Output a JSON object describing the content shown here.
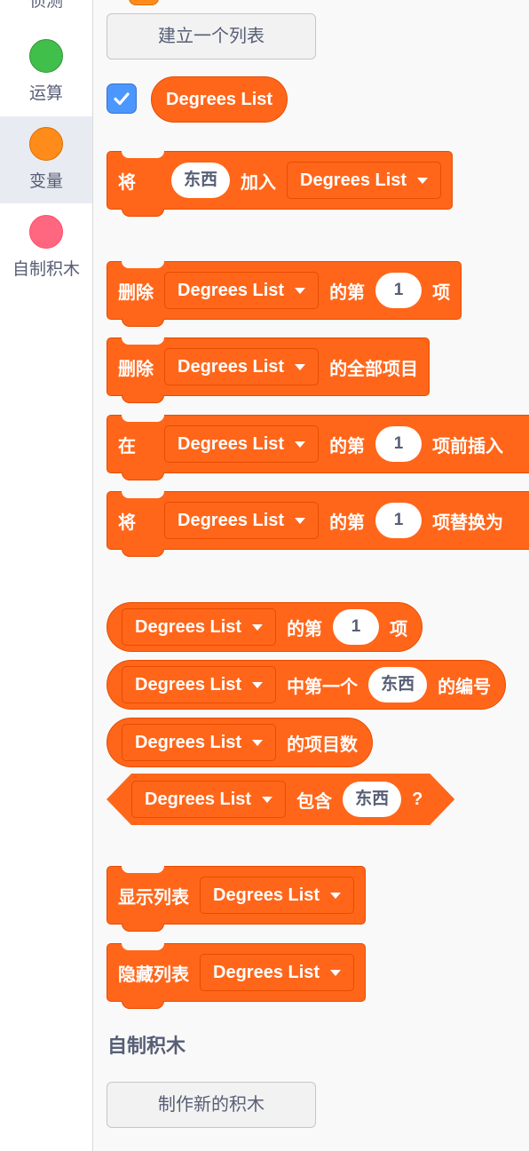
{
  "categories": [
    {
      "label": "侦测",
      "color": "#5cb1d6"
    },
    {
      "label": "运算",
      "color": "#40bf4a"
    },
    {
      "label": "变量",
      "color": "#ff8c1a"
    },
    {
      "label": "自制积木",
      "color": "#ff6680"
    }
  ],
  "palette": {
    "make_list_label": "建立一个列表",
    "list_name": "Degrees List",
    "list_checked": true,
    "add_block": {
      "w1": "将",
      "input": "东西",
      "w2": "加入"
    },
    "delete_item": {
      "w1": "删除",
      "w2": "的第",
      "input": "1",
      "w3": "项"
    },
    "delete_all": {
      "w1": "删除",
      "w2": "的全部项目"
    },
    "insert": {
      "w1": "在",
      "w2": "的第",
      "input": "1",
      "w3": "项前插入"
    },
    "replace": {
      "w1": "将",
      "w2": "的第",
      "input": "1",
      "w3": "项替换为"
    },
    "item_of": {
      "w1": "的第",
      "input": "1",
      "w2": "项"
    },
    "index_of": {
      "w1": "中第一个",
      "input": "东西",
      "w2": "的编号"
    },
    "length": {
      "w1": "的项目数"
    },
    "contains": {
      "w1": "包含",
      "input": "东西",
      "w2": "?"
    },
    "show_list": {
      "w1": "显示列表"
    },
    "hide_list": {
      "w1": "隐藏列表"
    },
    "my_blocks_title": "自制积木",
    "make_block_label": "制作新的积木"
  },
  "colors": {
    "block": "#ff661a",
    "block_border": "#e64d00",
    "checkbox": "#4c97ff"
  }
}
